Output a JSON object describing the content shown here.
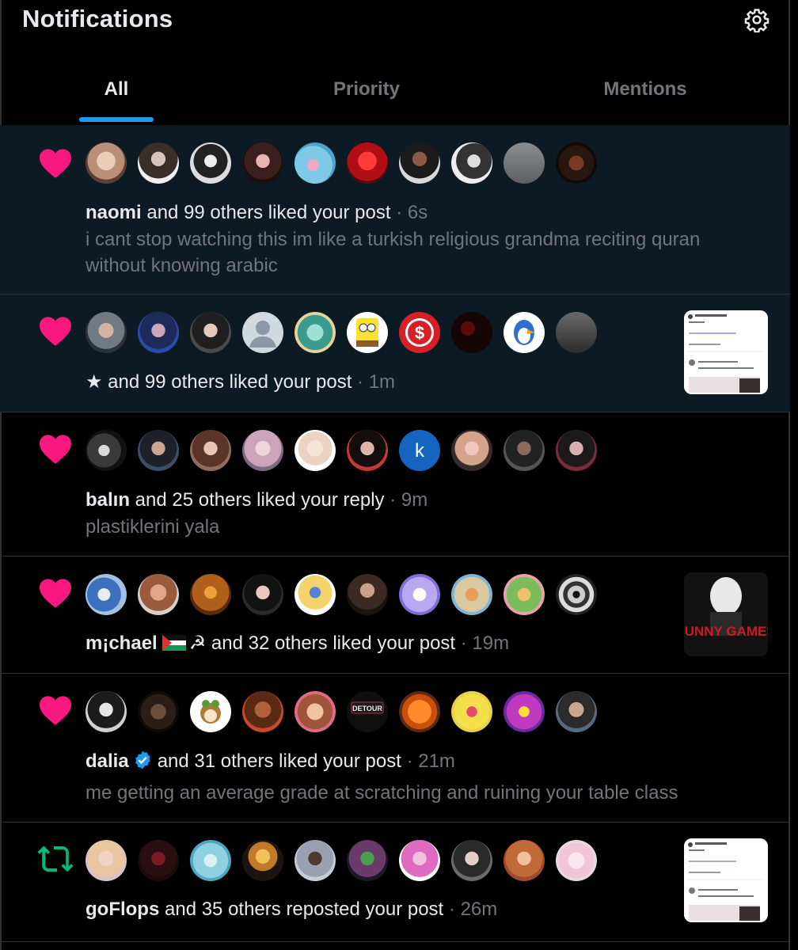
{
  "header": {
    "title": "Notifications",
    "settings_icon": "gear-icon"
  },
  "tabs": [
    {
      "label": "All",
      "active": true
    },
    {
      "label": "Priority",
      "active": false
    },
    {
      "label": "Mentions",
      "active": false
    }
  ],
  "colors": {
    "accent": "#1d9bf0",
    "like": "#f91880",
    "repost": "#00ba7c",
    "unread_bg": "#0c1a23",
    "muted": "#71767b"
  },
  "notifications": [
    {
      "kind": "like",
      "icon": "heart-icon",
      "actor": "naomi",
      "action": " and 99 others liked your post",
      "time": " · 6s",
      "preview": "i cant stop watching this im like a turkish religious grandma reciting quran without knowing arabic"
    },
    {
      "kind": "like",
      "icon": "heart-icon",
      "actor": "★",
      "action": " and 99 others liked your post",
      "time": " · 1m",
      "thumbnail": "tweet-screenshot"
    },
    {
      "kind": "like",
      "icon": "heart-icon",
      "actor": "balın",
      "action": " and 25 others liked your reply",
      "time": " · 9m",
      "preview": "plastiklerini yala",
      "avatar_letter": "k"
    },
    {
      "kind": "like",
      "icon": "heart-icon",
      "actor": "m¡chael",
      "actor_suffix": "☭",
      "action": " and 32 others liked your post",
      "time": " · 19m",
      "thumbnail_text": "FUNNY GAMES"
    },
    {
      "kind": "like",
      "icon": "heart-icon",
      "actor": "dalia",
      "action": "and 31 others liked your post",
      "time": " · 21m",
      "preview": "me getting an average grade at scratching and ruining your table class",
      "avatar_badge": "DETOUR"
    },
    {
      "kind": "repost",
      "icon": "repost-icon",
      "actor": "goFlops",
      "action": " and 35 others reposted your post",
      "time": " · 26m",
      "thumbnail": "tweet-screenshot"
    }
  ]
}
